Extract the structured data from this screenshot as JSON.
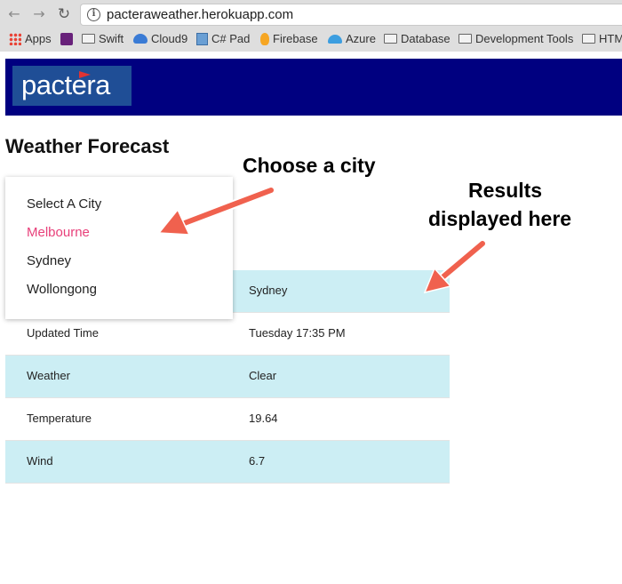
{
  "browser": {
    "url": "pacteraweather.herokuapp.com",
    "bookmarks": [
      {
        "label": "Apps",
        "icon": "apps-grid-icon"
      },
      {
        "label": "",
        "icon": "visual-studio-icon"
      },
      {
        "label": "Swift",
        "icon": "folder-icon"
      },
      {
        "label": "Cloud9",
        "icon": "cloud9-icon"
      },
      {
        "label": "C# Pad",
        "icon": "csharp-pad-icon"
      },
      {
        "label": "Firebase",
        "icon": "firebase-icon"
      },
      {
        "label": "Azure",
        "icon": "azure-icon"
      },
      {
        "label": "Database",
        "icon": "folder-icon"
      },
      {
        "label": "Development Tools",
        "icon": "folder-icon"
      },
      {
        "label": "HTM",
        "icon": "folder-icon"
      }
    ]
  },
  "header": {
    "logo_text": "pactera",
    "background": "#000080",
    "logo_background": "#1f4e96"
  },
  "page": {
    "title": "Weather Forecast"
  },
  "dropdown": {
    "items": [
      {
        "label": "Select A City"
      },
      {
        "label": "Melbourne"
      },
      {
        "label": "Sydney"
      },
      {
        "label": "Wollongong"
      }
    ],
    "highlighted": "Melbourne",
    "highlight_color": "#e8407a"
  },
  "results": {
    "rows": [
      {
        "label": "",
        "value": "Sydney"
      },
      {
        "label": "Updated Time",
        "value": "Tuesday 17:35 PM"
      },
      {
        "label": "Weather",
        "value": "Clear"
      },
      {
        "label": "Temperature",
        "value": "19.64"
      },
      {
        "label": "Wind",
        "value": "6.7"
      }
    ],
    "alt_row_color": "#cceef4"
  },
  "annotations": {
    "choose_city": "Choose a city",
    "results_line1": "Results",
    "results_line2": "displayed here",
    "arrow_color": "#f0614e"
  }
}
